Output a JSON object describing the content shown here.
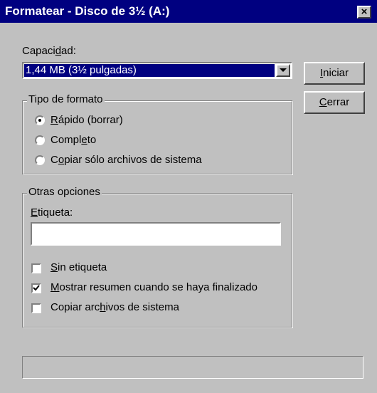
{
  "window": {
    "title": "Formatear - Disco de 3½ (A:)",
    "close_glyph": "×"
  },
  "capacity": {
    "label_pre": "Capaci",
    "label_key": "d",
    "label_post": "ad:",
    "selected_value": "1,44 MB (3½ pulgadas)",
    "arrow_icon": "down-arrow-icon"
  },
  "buttons": {
    "start": {
      "key": "I",
      "rest": "niciar"
    },
    "close": {
      "key": "C",
      "rest": "errar"
    }
  },
  "format_type": {
    "legend": "Tipo de formato",
    "options": [
      {
        "key": "R",
        "rest": "ápido (borrar)",
        "selected": true
      },
      {
        "pre": "Compl",
        "key": "e",
        "rest": "to",
        "selected": false
      },
      {
        "pre": "C",
        "key": "o",
        "rest": "piar sólo archivos de sistema",
        "selected": false
      }
    ]
  },
  "other_options": {
    "legend": "Otras opciones",
    "label": {
      "key": "E",
      "rest": "tiqueta:"
    },
    "label_value": "",
    "checkboxes": [
      {
        "key": "S",
        "rest": "in etiqueta",
        "checked": false
      },
      {
        "key": "M",
        "rest": "ostrar resumen cuando se haya finalizado",
        "checked": true
      },
      {
        "pre": "Copiar arc",
        "key": "h",
        "rest": "ivos de sistema",
        "checked": false
      }
    ]
  },
  "status": {
    "text": ""
  },
  "colors": {
    "titlebar": "#000080",
    "face": "#c0c0c0",
    "selection": "#000080"
  }
}
